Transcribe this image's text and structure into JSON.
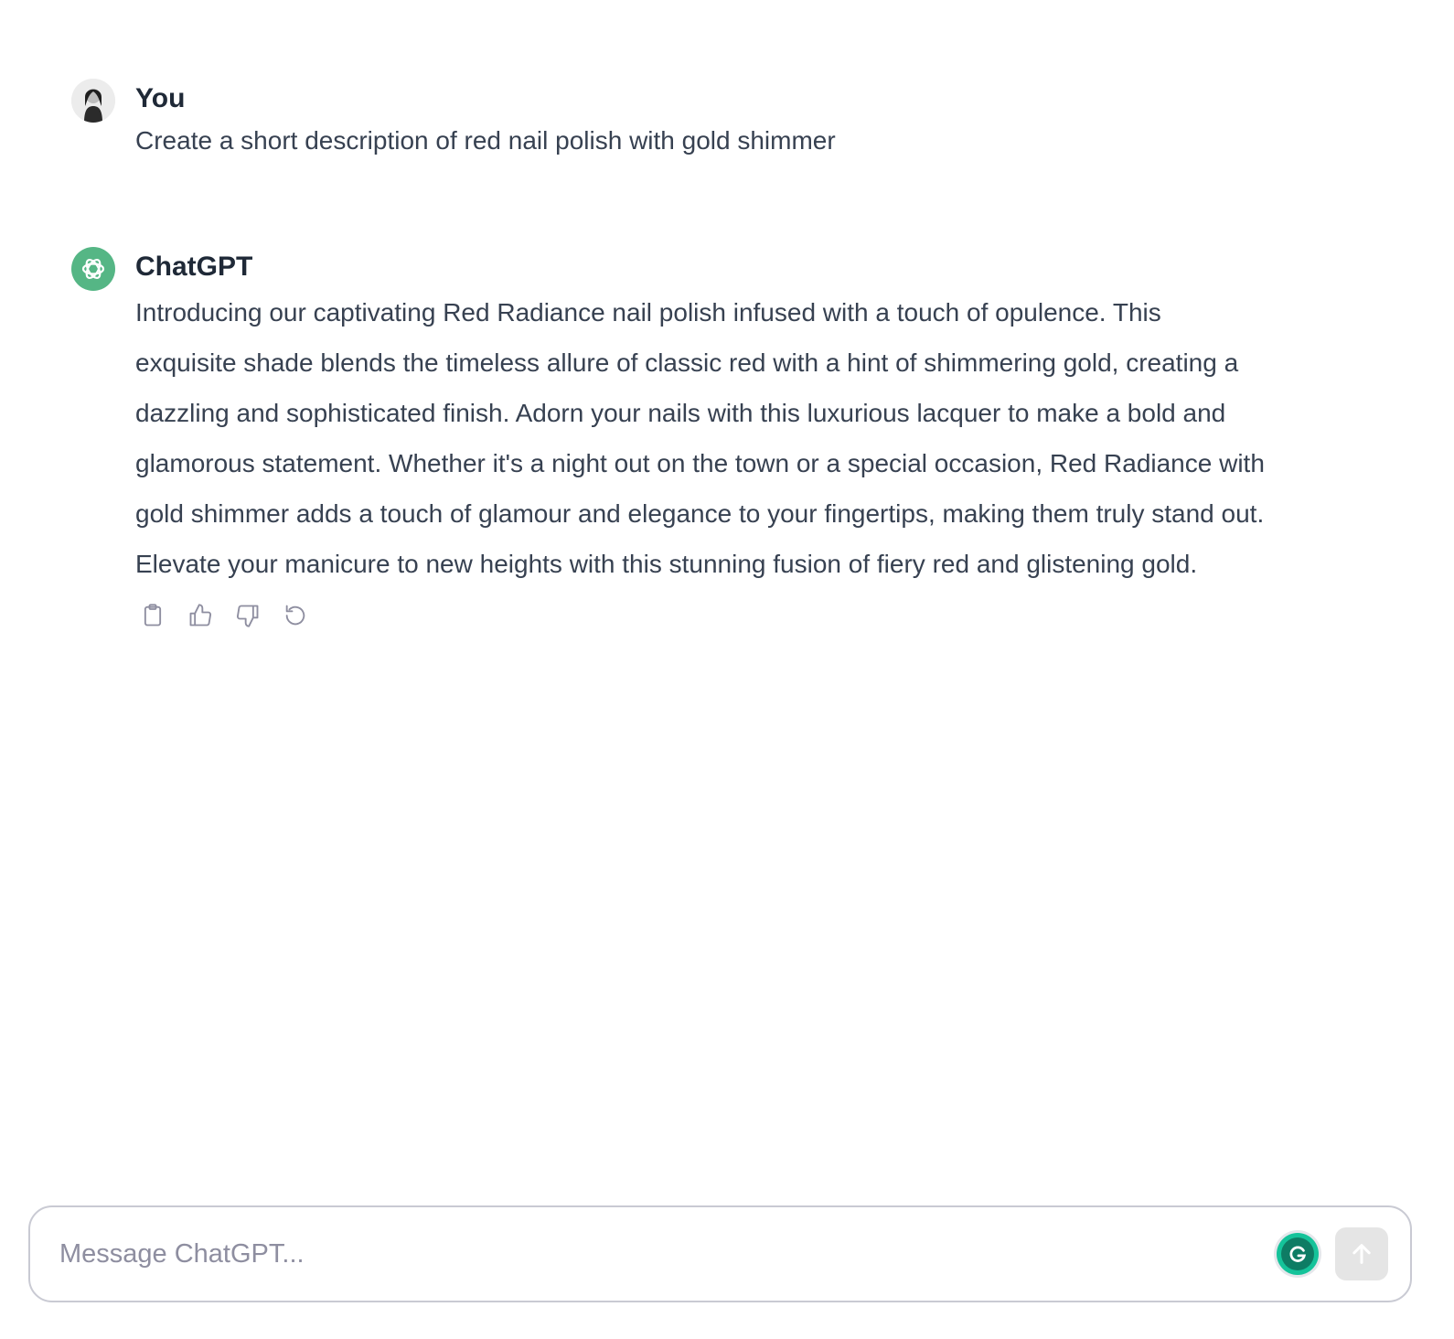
{
  "conversation": {
    "user_message": {
      "author": "You",
      "text": "Create a short description of red nail polish with gold shimmer",
      "avatar_icon": "user-photo-avatar"
    },
    "assistant_message": {
      "author": "ChatGPT",
      "text": "Introducing our captivating Red Radiance nail polish infused with a touch of opulence. This exquisite shade blends the timeless allure of classic red with a hint of shimmering gold, creating a dazzling and sophisticated finish. Adorn your nails with this luxurious lacquer to make a bold and glamorous statement. Whether it's a night out on the town or a special occasion, Red Radiance with gold shimmer adds a touch of glamour and elegance to your fingertips, making them truly stand out. Elevate your manicure to new heights with this stunning fusion of fiery red and glistening gold.",
      "avatar_icon": "openai-logo-icon",
      "avatar_color": "#55b685",
      "actions": [
        "copy-icon",
        "thumbs-up-icon",
        "thumbs-down-icon",
        "regenerate-icon"
      ]
    }
  },
  "composer": {
    "placeholder": "Message ChatGPT...",
    "value": "",
    "grammarly_icon": "grammarly-icon",
    "send_icon": "arrow-up-icon"
  }
}
